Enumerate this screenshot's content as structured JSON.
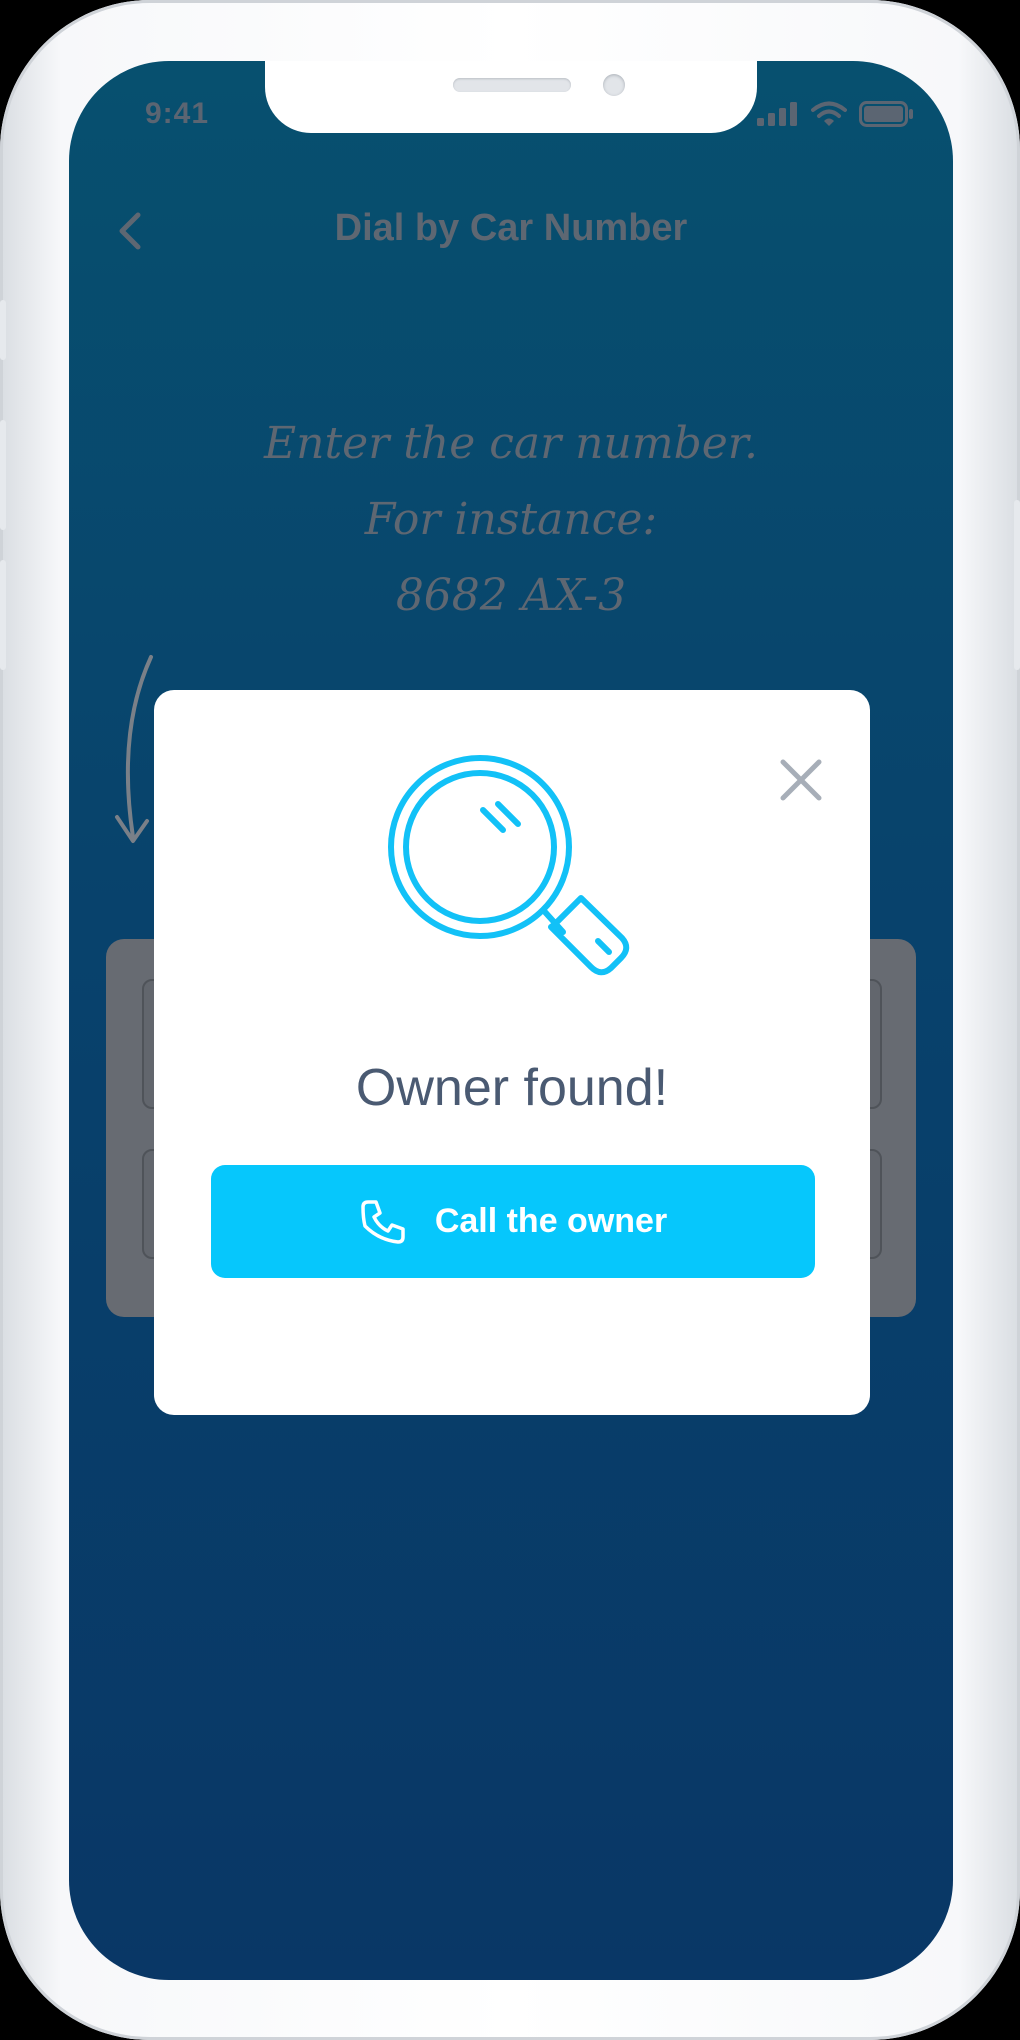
{
  "status_bar": {
    "time": "9:41",
    "icons": [
      "signal-icon",
      "wifi-icon",
      "battery-icon"
    ]
  },
  "nav": {
    "title": "Dial by Car Number",
    "back_icon": "chevron-left-icon"
  },
  "hint": {
    "line1": "Enter the car number.",
    "line2": "For instance:",
    "line3": "8682 AX-3"
  },
  "modal": {
    "title": "Owner found!",
    "icon": "magnifier-icon",
    "close_icon": "close-icon",
    "button_label": "Call the owner",
    "button_icon": "phone-icon"
  },
  "colors": {
    "accent": "#06C7FC",
    "screen_top": "#07506F",
    "screen_bottom": "#093766",
    "modal_title": "#4A5A72"
  }
}
